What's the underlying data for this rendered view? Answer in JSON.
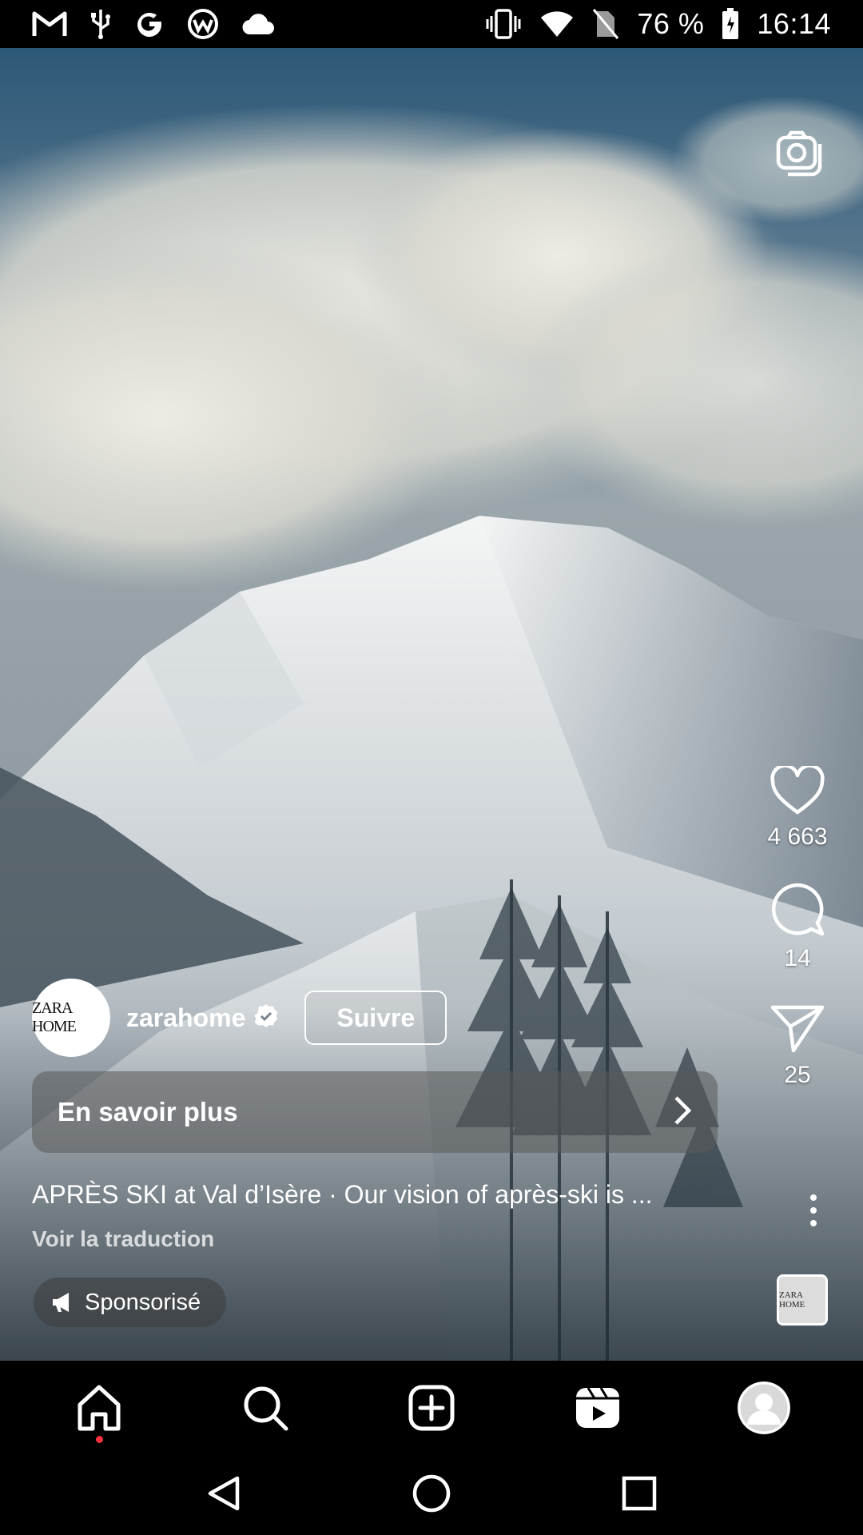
{
  "status_bar": {
    "battery_text": "76 %",
    "time": "16:14",
    "left_icons": [
      "gmail-icon",
      "usb-icon",
      "google-icon",
      "app-icon",
      "cloud-icon"
    ],
    "right_icons": [
      "vibrate-icon",
      "wifi-icon",
      "no-sim-icon",
      "battery-icon"
    ]
  },
  "reel": {
    "likes": "4 663",
    "comments": "14",
    "shares": "25",
    "author": {
      "name": "zarahome",
      "avatar_text": "ZARA HOME",
      "follow_label": "Suivre"
    },
    "cta_label": "En savoir plus",
    "caption": "APRÈS SKI at Val d’Isère · Our vision of après-ski is ...",
    "translate_label": "Voir la traduction",
    "sponsored_label": "Sponsorisé",
    "audio_text": "ZARA HOME"
  },
  "bottom_nav": [
    "home",
    "search",
    "create",
    "reels",
    "profile"
  ],
  "colors": {
    "notification_dot": "#ff3040",
    "background": "#000000"
  }
}
